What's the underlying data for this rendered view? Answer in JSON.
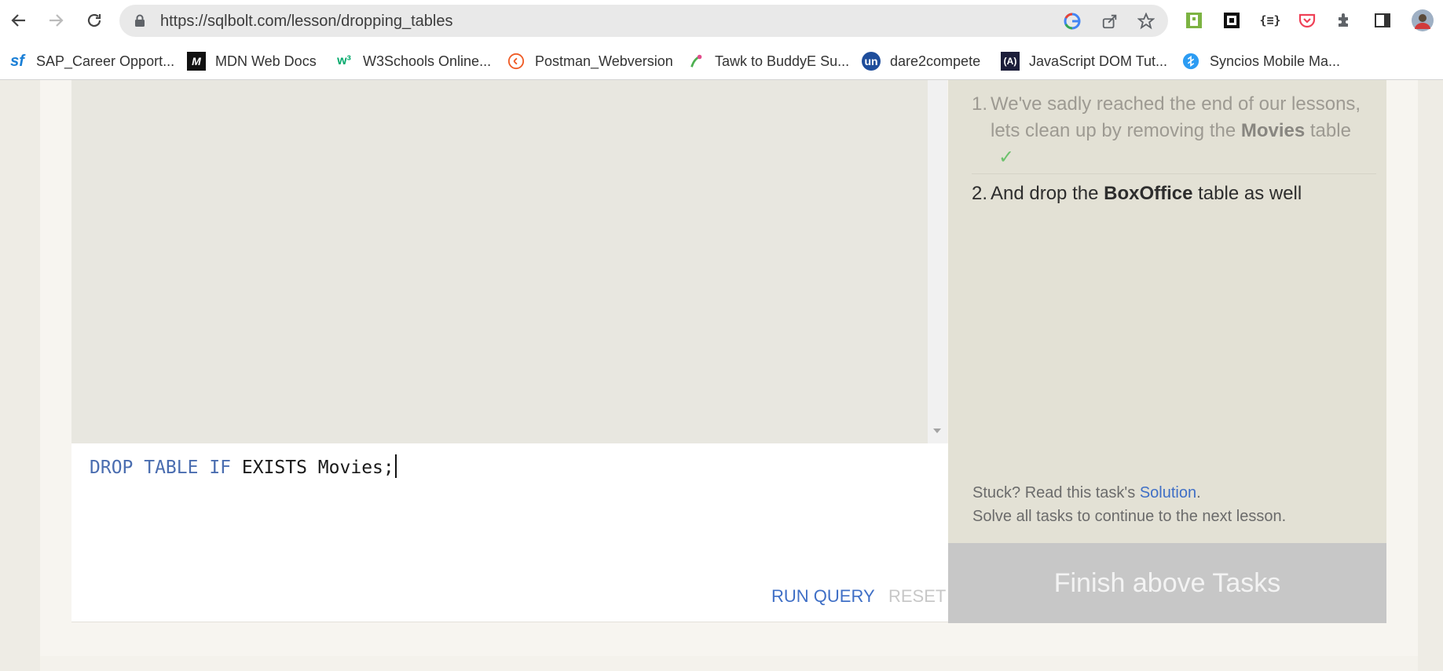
{
  "browser": {
    "url": "https://sqlbolt.com/lesson/dropping_tables",
    "bookmarks": [
      {
        "label": "SAP_Career Opport...",
        "icon": "sf-icon",
        "color": "#1a7fd6"
      },
      {
        "label": "MDN Web Docs",
        "icon": "mdn-icon",
        "color": "#111111"
      },
      {
        "label": "W3Schools Online...",
        "icon": "w3schools-icon",
        "color": "#04aa6d"
      },
      {
        "label": "Postman_Webversion",
        "icon": "postman-icon",
        "color": "#ef5b25"
      },
      {
        "label": "Tawk to BuddyE Su...",
        "icon": "tawk-icon",
        "color": "#4caf50"
      },
      {
        "label": "dare2compete",
        "icon": "unstop-icon",
        "color": "#1e4d9b"
      },
      {
        "label": "JavaScript DOM Tut...",
        "icon": "javascript-icon",
        "color": "#1c1e3a"
      },
      {
        "label": "Syncios Mobile Ma...",
        "icon": "syncios-icon",
        "color": "#2c9cf3"
      }
    ]
  },
  "editor": {
    "keywords": "DROP TABLE IF",
    "rest": "EXISTS Movies;",
    "run_label": "RUN QUERY",
    "reset_label": "RESET"
  },
  "tasks": {
    "items": [
      {
        "number": "1.",
        "before": "We've sadly reached the end of our lessons, lets clean up by removing the ",
        "bold": "Movies",
        "after": " table",
        "done": true
      },
      {
        "number": "2.",
        "before": "And drop the ",
        "bold": "BoxOffice",
        "after": " table as well",
        "done": false
      }
    ],
    "checkmark": "✓",
    "stuck_prefix": "Stuck? Read this task's ",
    "solution_link": "Solution",
    "stuck_suffix": ".",
    "continue_note": "Solve all tasks to continue to the next lesson.",
    "finish_label": "Finish above Tasks"
  }
}
